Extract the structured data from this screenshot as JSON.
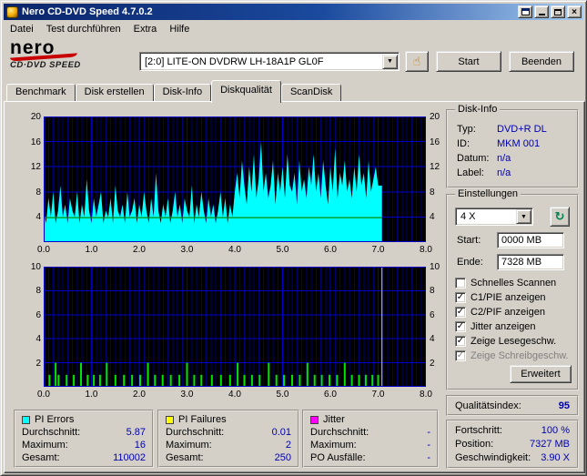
{
  "window": {
    "title": "Nero CD-DVD Speed 4.7.0.2"
  },
  "menu": {
    "items": [
      "Datei",
      "Test durchführen",
      "Extra",
      "Hilfe"
    ]
  },
  "logo": {
    "line1": "nero",
    "line2": "CD·DVD SPEED"
  },
  "toolbar": {
    "drive": "[2:0]  LITE-ON DVDRW LH-18A1P GL0F",
    "start_label": "Start",
    "quit_label": "Beenden"
  },
  "tabs": {
    "active_index": 3,
    "items": [
      {
        "label": "Benchmark"
      },
      {
        "label": "Disk erstellen"
      },
      {
        "label": "Disk-Info"
      },
      {
        "label": "Diskqualität"
      },
      {
        "label": "ScanDisk"
      }
    ]
  },
  "disk_info": {
    "title": "Disk-Info",
    "rows": [
      {
        "label": "Typ:",
        "value": "DVD+R DL"
      },
      {
        "label": "ID:",
        "value": "MKM 001"
      },
      {
        "label": "Datum:",
        "value": "n/a"
      },
      {
        "label": "Label:",
        "value": "n/a"
      }
    ]
  },
  "settings": {
    "title": "Einstellungen",
    "speed": "4 X",
    "start_label": "Start:",
    "start_value": "0000 MB",
    "end_label": "Ende:",
    "end_value": "7328 MB",
    "advanced_label": "Erweitert",
    "checkboxes": [
      {
        "label": "Schnelles Scannen",
        "checked": false,
        "disabled": false
      },
      {
        "label": "C1/PIE anzeigen",
        "checked": true,
        "disabled": false
      },
      {
        "label": "C2/PIF anzeigen",
        "checked": true,
        "disabled": false
      },
      {
        "label": "Jitter anzeigen",
        "checked": true,
        "disabled": false
      },
      {
        "label": "Zeige Lesegeschw.",
        "checked": true,
        "disabled": false
      },
      {
        "label": "Zeige Schreibgeschw.",
        "checked": true,
        "disabled": true
      }
    ]
  },
  "quality": {
    "label": "Qualitätsindex:",
    "value": "95"
  },
  "progress": {
    "rows": [
      {
        "label": "Fortschritt:",
        "value": "100 %"
      },
      {
        "label": "Position:",
        "value": "7327 MB"
      },
      {
        "label": "Geschwindigkeit:",
        "value": "3.90 X"
      }
    ]
  },
  "stats": [
    {
      "title": "PI Errors",
      "color": "#00ffff",
      "rows": [
        [
          "Durchschnitt:",
          "5.87"
        ],
        [
          "Maximum:",
          "16"
        ],
        [
          "Gesamt:",
          "110002"
        ]
      ]
    },
    {
      "title": "PI Failures",
      "color": "#ffff00",
      "rows": [
        [
          "Durchschnitt:",
          "0.01"
        ],
        [
          "Maximum:",
          "2"
        ],
        [
          "Gesamt:",
          "250"
        ]
      ]
    },
    {
      "title": "Jitter",
      "color": "#ff00ff",
      "rows": [
        [
          "Durchschnitt:",
          "-"
        ],
        [
          "Maximum:",
          "-"
        ],
        [
          "PO Ausfälle:",
          "-"
        ]
      ]
    }
  ],
  "chart_data": [
    {
      "type": "area",
      "name": "PI Errors",
      "x_range": [
        0,
        8
      ],
      "ylim": [
        0,
        20
      ],
      "y_ticks": [
        4,
        8,
        12,
        16,
        20
      ],
      "x_ticks": [
        "0.0",
        "1.0",
        "2.0",
        "3.0",
        "4.0",
        "5.0",
        "6.0",
        "7.0",
        "8.0"
      ],
      "x_step": 0.05,
      "scan_end": 7.08,
      "speed_line": 3.9,
      "values": [
        5,
        3,
        7,
        4,
        8,
        3,
        5,
        9,
        4,
        6,
        3,
        7,
        5,
        4,
        8,
        3,
        6,
        4,
        10,
        5,
        3,
        7,
        4,
        6,
        8,
        3,
        5,
        4,
        7,
        3,
        9,
        5,
        4,
        6,
        3,
        8,
        4,
        5,
        7,
        3,
        6,
        4,
        8,
        5,
        3,
        7,
        4,
        11,
        5,
        3,
        6,
        4,
        7,
        3,
        5,
        8,
        4,
        6,
        3,
        7,
        5,
        4,
        9,
        3,
        6,
        4,
        8,
        5,
        3,
        7,
        4,
        6,
        3,
        5,
        8,
        4,
        7,
        3,
        6,
        4,
        8,
        11,
        7,
        13,
        9,
        6,
        12,
        8,
        14,
        7,
        10,
        16,
        8,
        11,
        7,
        9,
        13,
        6,
        11,
        8,
        12,
        7,
        14,
        9,
        8,
        11,
        6,
        13,
        8,
        10,
        7,
        12,
        9,
        14,
        8,
        11,
        7,
        13,
        9,
        6,
        12,
        8,
        15,
        7,
        11,
        9,
        13,
        8,
        10,
        7,
        12,
        8,
        14,
        9,
        11,
        7,
        13,
        8,
        10,
        12,
        9
      ],
      "colors": {
        "data": "#00ffff",
        "speed": "#008f00",
        "bg": "#000000",
        "grid_major": "#0000c8",
        "grid_minor": "#000070"
      }
    },
    {
      "type": "bar",
      "name": "PI Failures",
      "x_range": [
        0,
        8
      ],
      "ylim": [
        0,
        10
      ],
      "y_ticks": [
        2,
        4,
        6,
        8,
        10
      ],
      "x_ticks": [
        "0.0",
        "1.0",
        "2.0",
        "3.0",
        "4.0",
        "5.0",
        "6.0",
        "7.0",
        "8.0"
      ],
      "end_marker": 7.08,
      "spikes": [
        [
          0.12,
          1
        ],
        [
          0.25,
          2
        ],
        [
          0.31,
          1
        ],
        [
          0.48,
          1
        ],
        [
          0.63,
          1
        ],
        [
          0.78,
          2
        ],
        [
          0.92,
          1
        ],
        [
          1.05,
          1
        ],
        [
          1.18,
          1
        ],
        [
          1.32,
          2
        ],
        [
          1.5,
          1
        ],
        [
          1.68,
          1
        ],
        [
          1.85,
          1
        ],
        [
          2.02,
          1
        ],
        [
          2.18,
          2
        ],
        [
          2.33,
          1
        ],
        [
          2.49,
          1
        ],
        [
          2.66,
          1
        ],
        [
          2.84,
          1
        ],
        [
          3.0,
          2
        ],
        [
          3.15,
          1
        ],
        [
          3.3,
          1
        ],
        [
          3.52,
          1
        ],
        [
          3.71,
          1
        ],
        [
          3.9,
          1
        ],
        [
          4.06,
          2
        ],
        [
          4.2,
          1
        ],
        [
          4.36,
          1
        ],
        [
          4.52,
          1
        ],
        [
          4.71,
          2
        ],
        [
          4.87,
          1
        ],
        [
          5.03,
          1
        ],
        [
          5.2,
          1
        ],
        [
          5.36,
          1
        ],
        [
          5.52,
          2
        ],
        [
          5.67,
          1
        ],
        [
          5.82,
          1
        ],
        [
          5.98,
          1
        ],
        [
          6.14,
          1
        ],
        [
          6.3,
          2
        ],
        [
          6.45,
          1
        ],
        [
          6.6,
          1
        ],
        [
          6.74,
          1
        ],
        [
          6.88,
          1
        ],
        [
          7.0,
          1
        ]
      ],
      "colors": {
        "data": "#00e600",
        "bg": "#000000",
        "grid_major": "#0000c8",
        "grid_minor": "#000070",
        "end_marker": "#cccccc"
      }
    }
  ]
}
